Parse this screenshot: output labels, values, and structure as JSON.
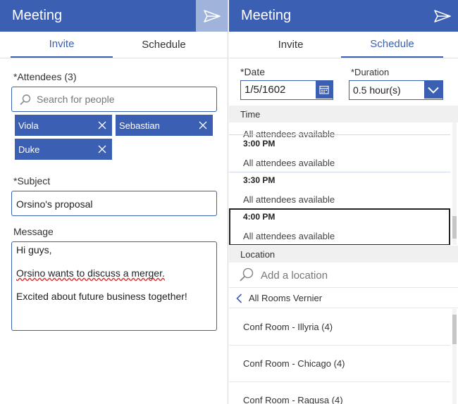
{
  "left": {
    "header": {
      "title": "Meeting"
    },
    "tabs": [
      {
        "label": "Invite",
        "active": true
      },
      {
        "label": "Schedule",
        "active": false
      }
    ],
    "attendees": {
      "label": "*Attendees (3)",
      "search_placeholder": "Search for people",
      "chips": [
        "Viola",
        "Sebastian",
        "Duke"
      ]
    },
    "subject": {
      "label": "*Subject",
      "value": "Orsino's proposal"
    },
    "message": {
      "label": "Message",
      "lines": [
        "Hi guys,",
        "Orsino wants to discuss a merger.",
        "Excited about future business together!"
      ]
    }
  },
  "right": {
    "header": {
      "title": "Meeting"
    },
    "tabs": [
      {
        "label": "Invite",
        "active": false
      },
      {
        "label": "Schedule",
        "active": true
      }
    ],
    "date": {
      "label": "*Date",
      "value": "1/5/1602"
    },
    "duration": {
      "label": "*Duration",
      "value": "0.5 hour(s)"
    },
    "time": {
      "header": "Time",
      "partial_availability": "All attendees available",
      "slots": [
        {
          "time": "3:00 PM",
          "availability": "All attendees available"
        },
        {
          "time": "3:30 PM",
          "availability": "All attendees available"
        },
        {
          "time": "4:00 PM",
          "availability": "All attendees available",
          "selected": true
        }
      ]
    },
    "location": {
      "header": "Location",
      "search_placeholder": "Add a location",
      "breadcrumb": "All Rooms Vernier",
      "rooms": [
        "Conf Room - Illyria (4)",
        "Conf Room - Chicago (4)",
        "Conf Room - Ragusa (4)"
      ]
    }
  },
  "colors": {
    "accent": "#3b5fb3",
    "send_disabled_bg": "#9fb3db"
  },
  "icons": [
    "send-icon",
    "search-icon",
    "close-icon",
    "calendar-icon",
    "chevron-down-icon",
    "chevron-left-icon"
  ]
}
